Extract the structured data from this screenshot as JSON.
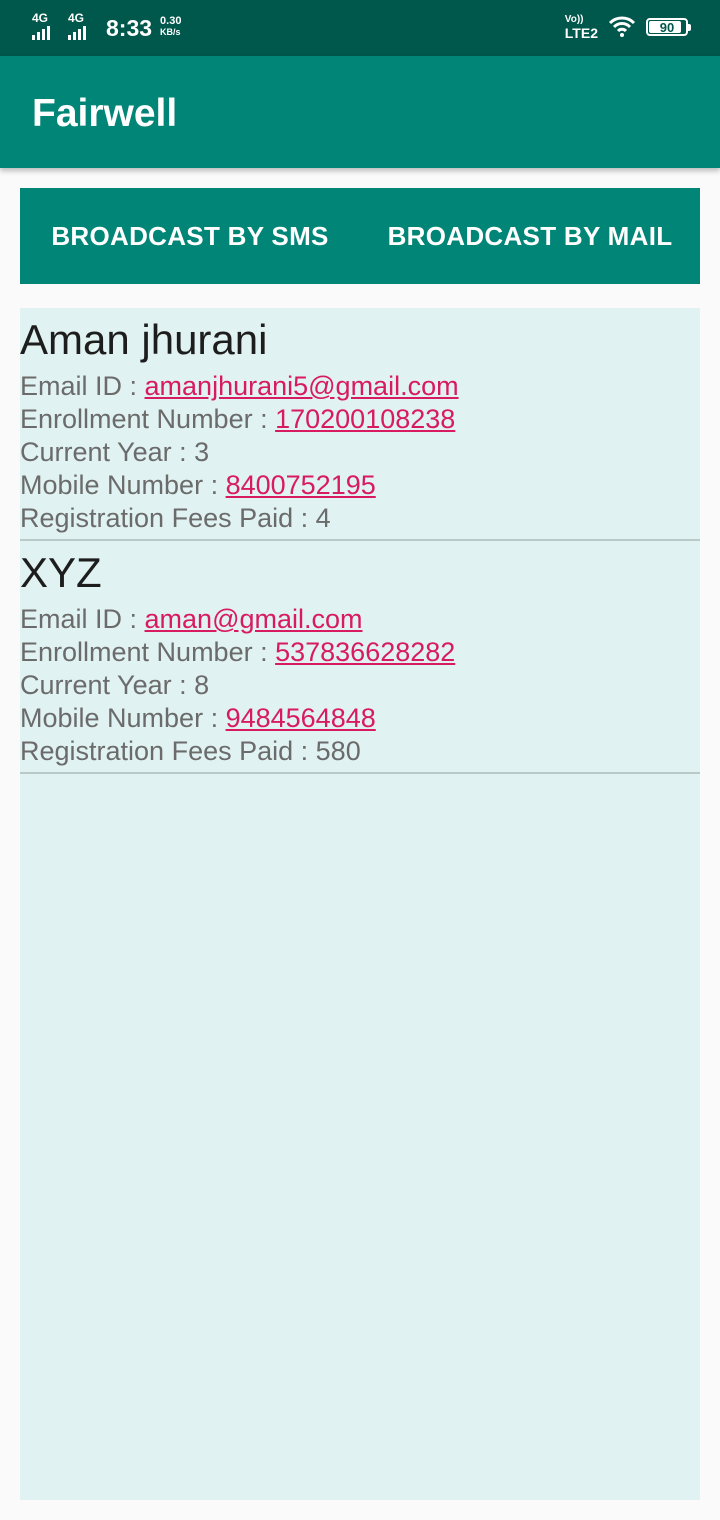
{
  "status_bar": {
    "net1": "4G",
    "net2": "4G",
    "time": "8:33",
    "speed_value": "0.30",
    "speed_unit": "KB/s",
    "volte_top": "Vo))",
    "volte_bottom": "LTE2",
    "battery_level": "90",
    "text_color": "#ffffff",
    "background": "#00574b"
  },
  "app_bar": {
    "title": "Fairwell",
    "background": "#008577"
  },
  "actions": {
    "sms_label": "BROADCAST BY SMS",
    "mail_label": "BROADCAST BY MAIL"
  },
  "labels": {
    "email": "Email ID : ",
    "enrollment": "Enrollment Number : ",
    "year": "Current Year : ",
    "mobile": "Mobile Number : ",
    "fees": "Registration Fees Paid : "
  },
  "students": [
    {
      "name": "Aman jhurani",
      "email": "amanjhurani5@gmail.com",
      "enrollment": "170200108238",
      "year": "3",
      "mobile": "8400752195",
      "fees": "4"
    },
    {
      "name": "XYZ",
      "email": "aman@gmail.com",
      "enrollment": "537836628282",
      "year": "8",
      "mobile": "9484564848",
      "fees": "580"
    }
  ],
  "colors": {
    "accent": "#008577",
    "link": "#d81b60",
    "list_background": "#e0f2f1"
  }
}
